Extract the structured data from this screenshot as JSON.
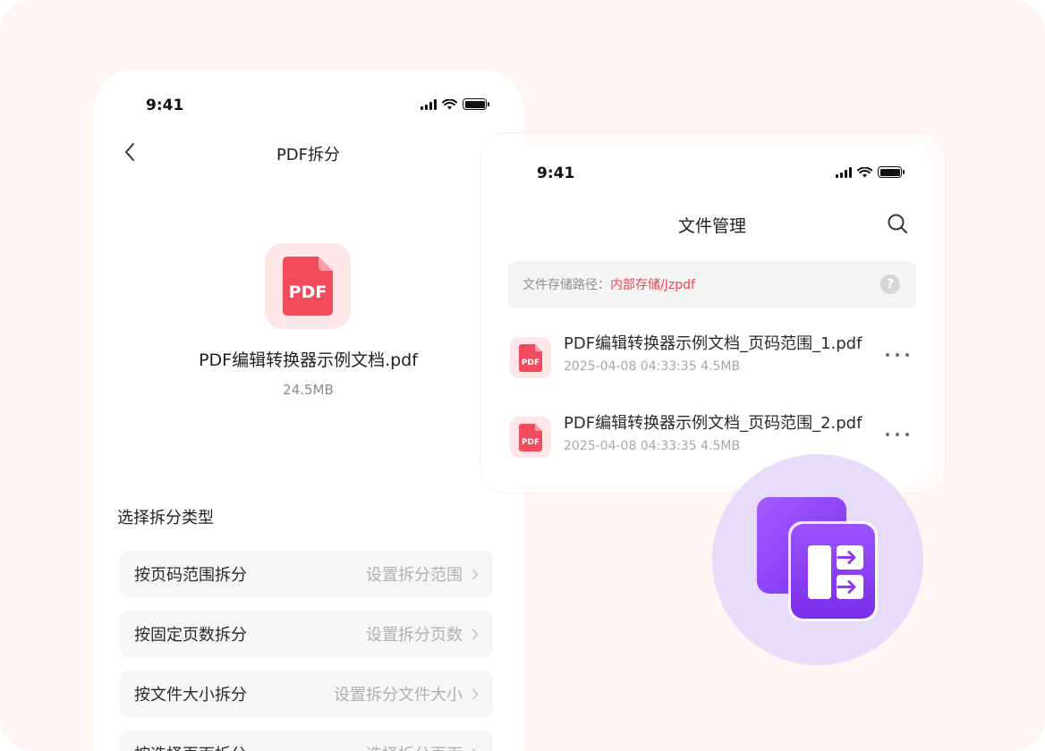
{
  "phone1": {
    "status_time": "9:41",
    "title": "PDF拆分",
    "file_badge": "PDF",
    "file_name": "PDF编辑转换器示例文档.pdf",
    "file_size": "24.5MB",
    "section_title": "选择拆分类型",
    "options": [
      {
        "label": "按页码范围拆分",
        "hint": "设置拆分范围"
      },
      {
        "label": "按固定页数拆分",
        "hint": "设置拆分页数"
      },
      {
        "label": "按文件大小拆分",
        "hint": "设置拆分文件大小"
      },
      {
        "label": "按选择页面拆分",
        "hint": "选择拆分页面"
      }
    ]
  },
  "phone2": {
    "status_time": "9:41",
    "title": "文件管理",
    "path_label": "文件存储路径：",
    "path_value": "内部存储/Jzpdf",
    "help": "?",
    "files": [
      {
        "badge": "PDF",
        "name": "PDF编辑转换器示例文档_页码范围_1.pdf",
        "meta": "2025-04-08 04:33:35   4.5MB"
      },
      {
        "badge": "PDF",
        "name": "PDF编辑转换器示例文档_页码范围_2.pdf",
        "meta": "2025-04-08 04:33:35   4.5MB"
      }
    ]
  },
  "colors": {
    "background": "#fff5f3",
    "pdf_red": "#f24b5e",
    "accent_red": "#f2414f",
    "badge_purple": "#8b3cf0",
    "badge_circle": "#e8dcfb"
  },
  "icons": [
    "chevron-left-icon",
    "signal-icon",
    "wifi-icon",
    "battery-icon",
    "search-icon",
    "help-icon",
    "more-icon",
    "chevron-right-icon",
    "split-pdf-icon"
  ]
}
